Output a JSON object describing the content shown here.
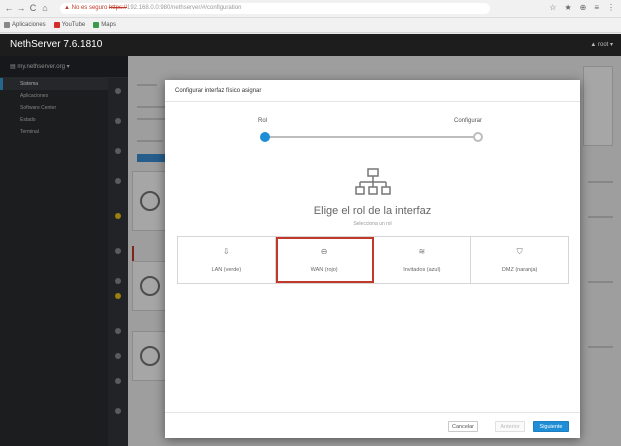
{
  "browser": {
    "nav_back": "←",
    "nav_forward": "→",
    "nav_reload": "C",
    "nav_home": "⌂",
    "security_warning": "▲ No es seguro",
    "url_protocol": "https://",
    "url_rest": "192.168.0.0:980/nethserver/#/configuration",
    "toolbar_icons": [
      "☆",
      "★",
      "⊕",
      "≡",
      "⋮"
    ],
    "bookmarks": [
      {
        "label": "Aplicaciones",
        "color": "#888888"
      },
      {
        "label": "YouTube",
        "color": "#d62b2b"
      },
      {
        "label": "Maps",
        "color": "#3a9b4a"
      }
    ]
  },
  "app": {
    "brand": "NethServer 7.6.1810",
    "user_menu": "▲ root ▾"
  },
  "sidebar": {
    "header": "▤ my.nethserver.org ▾",
    "items": [
      {
        "label": "Sistema",
        "active": true
      },
      {
        "label": "Aplicaciones",
        "active": false
      },
      {
        "label": "Software Center",
        "active": false
      },
      {
        "label": "Estado",
        "active": false
      },
      {
        "label": "Terminal",
        "active": false
      }
    ]
  },
  "modal": {
    "title": "Configurar interfaz físico asignar",
    "steps": [
      {
        "label": "Rol",
        "state": "active"
      },
      {
        "label": "Configurar",
        "state": "inactive"
      }
    ],
    "role_heading": "Elige el rol de la interfaz",
    "role_subtitle": "Selecciona un rol",
    "roles": [
      {
        "label": "LAN (verde)",
        "icon": "⇩",
        "selected": false
      },
      {
        "label": "WAN (rojo)",
        "icon": "⊖",
        "selected": true
      },
      {
        "label": "Invitados (azul)",
        "icon": "≋",
        "selected": false
      },
      {
        "label": "DMZ (naranja)",
        "icon": "⛉",
        "selected": false
      }
    ],
    "buttons": {
      "cancel": "Cancelar",
      "previous": "Anterior",
      "next": "Siguiente"
    }
  },
  "colors": {
    "accent": "#1f8ed6",
    "selected_border": "#c0392b",
    "header_bg": "#1d1d1d",
    "sidebar_bg": "#2b2d31"
  }
}
